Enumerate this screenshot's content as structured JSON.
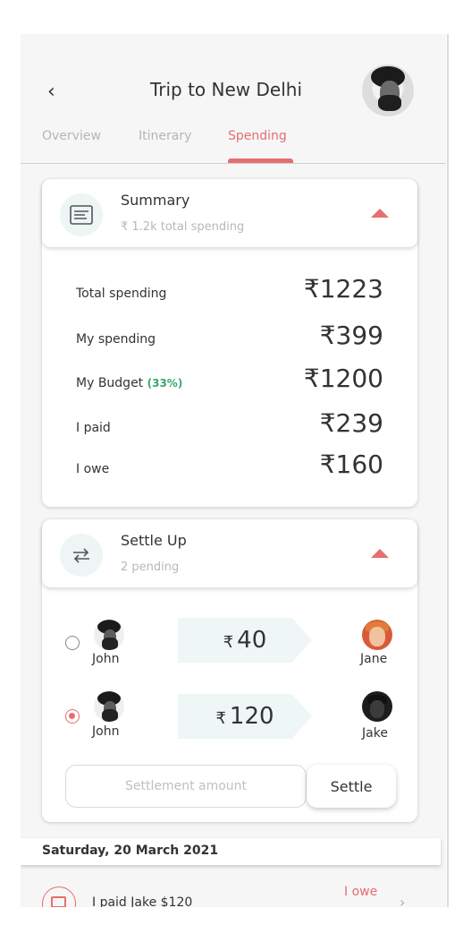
{
  "header": {
    "title": "Trip to New Delhi",
    "back_icon": "‹"
  },
  "tabs": [
    {
      "label": "Overview"
    },
    {
      "label": "Itinerary"
    },
    {
      "label": "Spending"
    }
  ],
  "active_tab": "Spending",
  "colors": {
    "accent": "#e66e6e",
    "green": "#3aa76d",
    "icon_bg": "#eef5f5"
  },
  "summary": {
    "title": "Summary",
    "subtitle": "₹ 1.2k total spending",
    "icon": "receipt-icon",
    "rows": [
      {
        "label": "Total spending",
        "value": "₹1223"
      },
      {
        "label": "My spending",
        "value": "₹399"
      },
      {
        "label": "My Budget",
        "pct": "(33%)",
        "value": "₹1200"
      },
      {
        "label": "I paid",
        "value": "₹239"
      },
      {
        "label": "I owe",
        "value": "₹160"
      }
    ]
  },
  "settle": {
    "title": "Settle Up",
    "subtitle": "2 pending",
    "icon": "transfer-icon",
    "items": [
      {
        "from": "John",
        "currency": "₹",
        "amount": "40",
        "to": "Jane",
        "selected": false
      },
      {
        "from": "John",
        "currency": "₹",
        "amount": "120",
        "to": "Jake",
        "selected": true
      }
    ],
    "placeholder": "Settlement amount",
    "button_label": "Settle"
  },
  "date_header": "Saturday, 20 March 2021",
  "transaction": {
    "text": "I paid Jake $120",
    "status": "I owe"
  }
}
